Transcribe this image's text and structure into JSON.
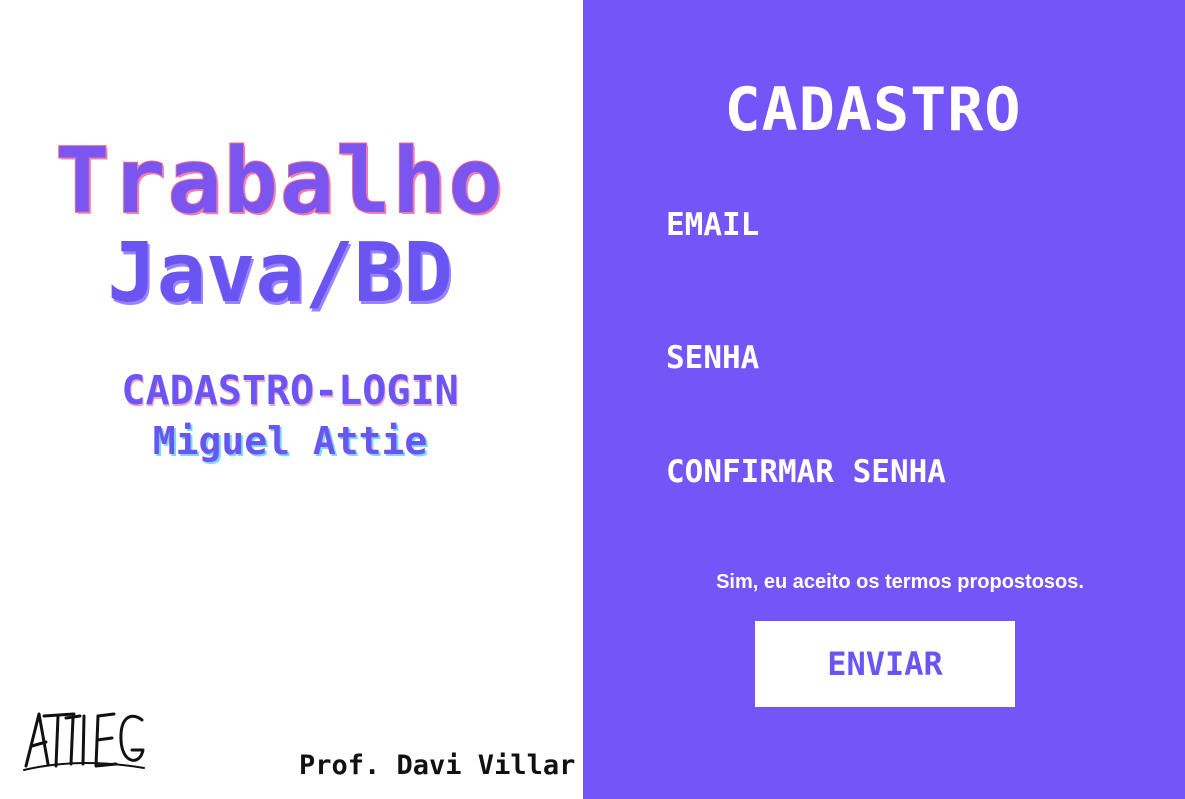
{
  "colors": {
    "accent": "#7455f7",
    "title_purple": "#6c55f5",
    "title_stroke": "#f06a8a",
    "subtitle_shadow": "#7bd9f3",
    "white": "#ffffff",
    "text_dark": "#111111"
  },
  "left": {
    "title_line_1": "Trabalho",
    "title_line_2": "Java/BD",
    "subtitle": "CADASTRO-LOGIN",
    "author": "Miguel Attie",
    "signature_text": "ATTIE",
    "professor": "Prof. Davi Villar"
  },
  "form": {
    "title": "CADASTRO",
    "fields": [
      {
        "label": "EMAIL",
        "value": "",
        "placeholder": ""
      },
      {
        "label": "SENHA",
        "value": "",
        "placeholder": ""
      },
      {
        "label": "CONFIRMAR SENHA",
        "value": "",
        "placeholder": ""
      }
    ],
    "terms": "Sim, eu aceito os termos propostosos.",
    "submit": "ENVIAR"
  }
}
